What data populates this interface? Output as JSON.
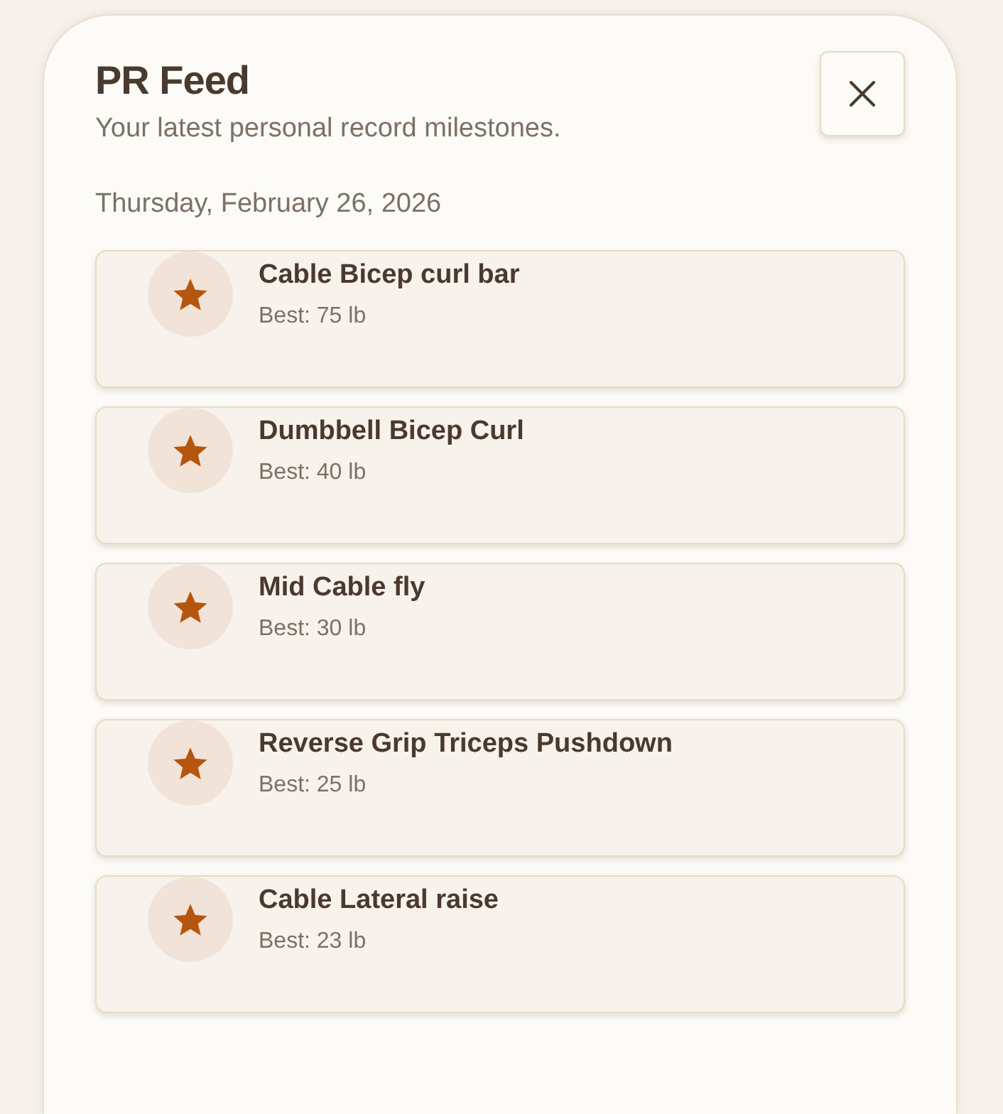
{
  "header": {
    "title": "PR Feed",
    "subtitle": "Your latest personal record milestones."
  },
  "date": "Thursday, February 26, 2026",
  "records": [
    {
      "exercise": "Cable Bicep curl bar",
      "best": "Best: 75 lb"
    },
    {
      "exercise": "Dumbbell Bicep Curl",
      "best": "Best: 40 lb"
    },
    {
      "exercise": "Mid Cable fly",
      "best": "Best: 30 lb"
    },
    {
      "exercise": "Reverse Grip Triceps Pushdown",
      "best": "Best: 25 lb"
    },
    {
      "exercise": "Cable Lateral raise",
      "best": "Best: 23 lb"
    }
  ]
}
